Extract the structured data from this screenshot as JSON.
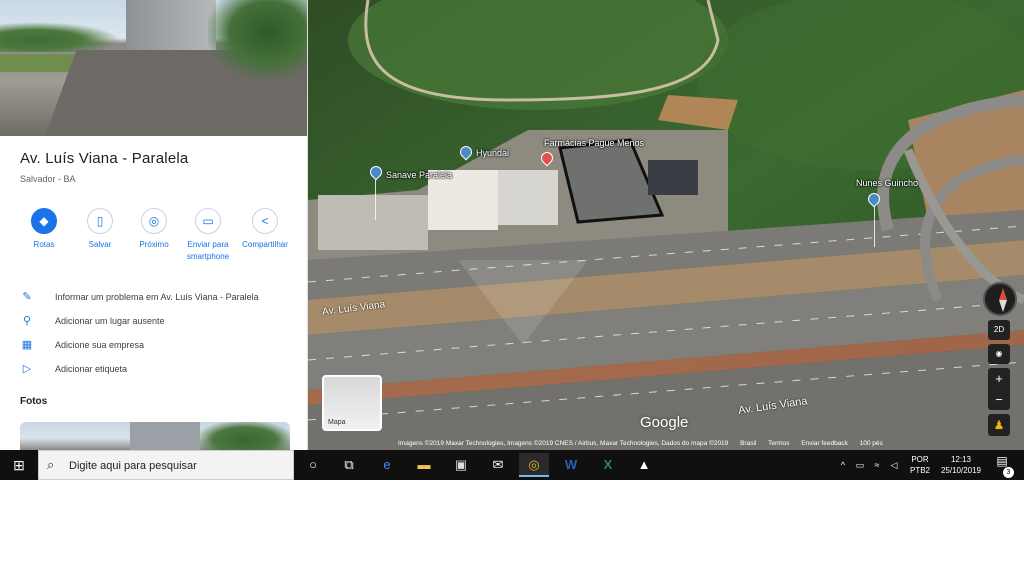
{
  "place": {
    "title": "Av. Luís Viana - Paralela",
    "subtitle": "Salvador - BA"
  },
  "actions": [
    {
      "label": "Rotas",
      "icon": "directions-icon"
    },
    {
      "label": "Salvar",
      "icon": "bookmark-icon"
    },
    {
      "label": "Próximo",
      "icon": "nearby-icon"
    },
    {
      "label": "Enviar para smartphone",
      "icon": "send-to-phone-icon"
    },
    {
      "label": "Compartilhar",
      "icon": "share-icon"
    }
  ],
  "info_rows": [
    {
      "label": "Informar um problema em Av. Luís Viana - Paralela",
      "icon": "pencil-icon"
    },
    {
      "label": "Adicionar um lugar ausente",
      "icon": "add-place-icon"
    },
    {
      "label": "Adicione sua empresa",
      "icon": "store-icon"
    },
    {
      "label": "Adicionar etiqueta",
      "icon": "label-icon"
    }
  ],
  "photos_title": "Fotos",
  "map": {
    "labels": {
      "sanave": "Sanave Paralela",
      "hyundai": "Hyundai",
      "farmacia": "Farmácias Pague Menos",
      "nunes": "Nunes Guincho"
    },
    "road_1": "Av. Luís Viana",
    "road_2": "Av. Luís Viana",
    "google": "Google",
    "mapa_label": "Mapa",
    "attribution": {
      "imagery": "Imagens ©2019 Maxar Technologies, Imagens ©2019 CNES / Airbus, Maxar Technologies, Dados do mapa ©2019",
      "brasil": "Brasil",
      "termos": "Termos",
      "feedback": "Enviar feedback",
      "scale": "100 pés"
    },
    "controls": {
      "mode_2d": "2D",
      "zoom_in": "+",
      "zoom_out": "−"
    }
  },
  "taskbar": {
    "search_placeholder": "Digite aqui para pesquisar",
    "lang_top": "POR",
    "lang_bottom": "PTB2",
    "time": "12:13",
    "date": "25/10/2019",
    "notif_count": "3"
  }
}
